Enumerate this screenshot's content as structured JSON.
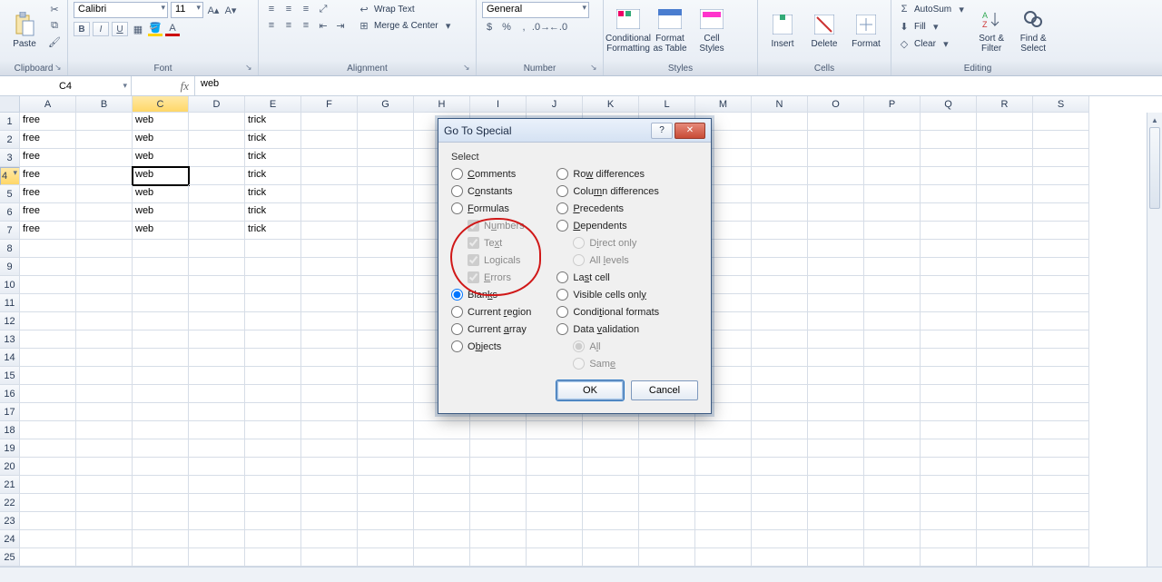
{
  "ribbon": {
    "groups": {
      "clipboard": {
        "label": "Clipboard",
        "paste": "Paste"
      },
      "font": {
        "label": "Font",
        "name": "Calibri",
        "size": "11",
        "bold": "B",
        "italic": "I",
        "underline": "U"
      },
      "alignment": {
        "label": "Alignment",
        "wrap": "Wrap Text",
        "merge": "Merge & Center"
      },
      "number": {
        "label": "Number",
        "format": "General"
      },
      "styles": {
        "label": "Styles",
        "cf": "Conditional Formatting",
        "fat": "Format as Table",
        "cs": "Cell Styles"
      },
      "cells": {
        "label": "Cells",
        "insert": "Insert",
        "delete": "Delete",
        "format": "Format"
      },
      "editing": {
        "label": "Editing",
        "autosum": "AutoSum",
        "fill": "Fill",
        "clear": "Clear",
        "sort": "Sort & Filter",
        "find": "Find & Select"
      }
    }
  },
  "namebox": "C4",
  "formula": "web",
  "columns": [
    "A",
    "B",
    "C",
    "D",
    "E",
    "F",
    "G",
    "H",
    "I",
    "J",
    "K",
    "L",
    "M",
    "N",
    "O",
    "P",
    "Q",
    "R",
    "S"
  ],
  "rows": 26,
  "active": {
    "row": 4,
    "col": "C"
  },
  "cells": {
    "A1": "free",
    "C1": "web",
    "E1": "trick",
    "A2": "free",
    "C2": "web",
    "E2": "trick",
    "A3": "free",
    "C3": "web",
    "E3": "trick",
    "A4": "free",
    "C4": "web",
    "E4": "trick",
    "A5": "free",
    "C5": "web",
    "E5": "trick",
    "A6": "free",
    "C6": "web",
    "E6": "trick",
    "A7": "free",
    "C7": "web",
    "E7": "trick"
  },
  "dialog": {
    "title": "Go To Special",
    "legend": "Select",
    "left": [
      {
        "id": "comments",
        "label_pre": "",
        "u": "C",
        "label_post": "omments",
        "type": "radio"
      },
      {
        "id": "constants",
        "label_pre": "C",
        "u": "o",
        "label_post": "nstants",
        "type": "radio"
      },
      {
        "id": "formulas",
        "label_pre": "",
        "u": "F",
        "label_post": "ormulas",
        "type": "radio"
      },
      {
        "id": "numbers",
        "label_pre": "N",
        "u": "u",
        "label_post": "mbers",
        "type": "check",
        "sub": true,
        "disabled": true,
        "checked": true
      },
      {
        "id": "text",
        "label_pre": "Te",
        "u": "x",
        "label_post": "t",
        "type": "check",
        "sub": true,
        "disabled": true,
        "checked": true
      },
      {
        "id": "logicals",
        "label_pre": "Lo",
        "u": "g",
        "label_post": "icals",
        "type": "check",
        "sub": true,
        "disabled": true,
        "checked": true
      },
      {
        "id": "errors",
        "label_pre": "",
        "u": "E",
        "label_post": "rrors",
        "type": "check",
        "sub": true,
        "disabled": true,
        "checked": true
      },
      {
        "id": "blanks",
        "label_pre": "Blan",
        "u": "k",
        "label_post": "s",
        "type": "radio",
        "checked": true
      },
      {
        "id": "cregion",
        "label_pre": "Current ",
        "u": "r",
        "label_post": "egion",
        "type": "radio"
      },
      {
        "id": "carray",
        "label_pre": "Current ",
        "u": "a",
        "label_post": "rray",
        "type": "radio"
      },
      {
        "id": "objects",
        "label_pre": "O",
        "u": "b",
        "label_post": "jects",
        "type": "radio"
      }
    ],
    "right": [
      {
        "id": "rowdiff",
        "label_pre": "Ro",
        "u": "w",
        "label_post": " differences",
        "type": "radio"
      },
      {
        "id": "coldiff",
        "label_pre": "Colu",
        "u": "m",
        "label_post": "n differences",
        "type": "radio"
      },
      {
        "id": "precedent",
        "label_pre": "",
        "u": "P",
        "label_post": "recedents",
        "type": "radio"
      },
      {
        "id": "dependent",
        "label_pre": "",
        "u": "D",
        "label_post": "ependents",
        "type": "radio"
      },
      {
        "id": "direct",
        "label_pre": "D",
        "u": "i",
        "label_post": "rect only",
        "type": "radio",
        "sub": true,
        "disabled": true,
        "checked": true
      },
      {
        "id": "alllev",
        "label_pre": "All ",
        "u": "l",
        "label_post": "evels",
        "type": "radio",
        "sub": true,
        "disabled": true
      },
      {
        "id": "lastcell",
        "label_pre": "La",
        "u": "s",
        "label_post": "t cell",
        "type": "radio"
      },
      {
        "id": "visible",
        "label_pre": "Visible cells onl",
        "u": "y",
        "label_post": "",
        "type": "radio"
      },
      {
        "id": "condfmt",
        "label_pre": "Condi",
        "u": "t",
        "label_post": "ional formats",
        "type": "radio"
      },
      {
        "id": "datavalid",
        "label_pre": "Data ",
        "u": "v",
        "label_post": "alidation",
        "type": "radio"
      },
      {
        "id": "all",
        "label_pre": "A",
        "u": "l",
        "label_post": "l",
        "type": "radio",
        "sub": true,
        "disabled": true,
        "checked": true
      },
      {
        "id": "same",
        "label_pre": "Sam",
        "u": "e",
        "label_post": "",
        "type": "radio",
        "sub": true,
        "disabled": true
      }
    ],
    "ok": "OK",
    "cancel": "Cancel"
  }
}
